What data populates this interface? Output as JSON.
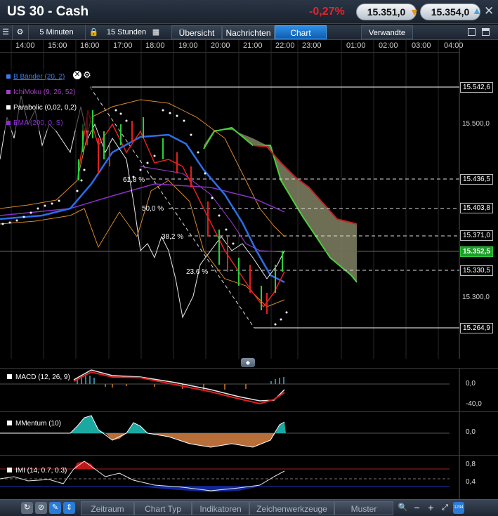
{
  "header": {
    "title": "US 30 - Cash",
    "change": "-0,27%",
    "bid": "15.351,0",
    "ask": "15.354,0"
  },
  "toolbar": {
    "interval": "5 Minuten",
    "range": "15 Stunden",
    "tabs": [
      "Übersicht",
      "Nachrichten",
      "Chart"
    ],
    "active_tab": "Chart",
    "related": "Verwandte"
  },
  "time_axis": [
    "14:00",
    "15:00",
    "16:00",
    "17:00",
    "18:00",
    "19:00",
    "20:00",
    "21:00",
    "22:00",
    "23:00",
    "01:00",
    "02:00",
    "03:00",
    "04:00"
  ],
  "price_axis": {
    "levels": [
      "15.542,6",
      "15.500,0",
      "15.436,5",
      "15.403,8",
      "15.371,0",
      "15.330,5",
      "15.300,0",
      "15.264,9"
    ],
    "current": "15.352,5"
  },
  "legend": {
    "items": [
      {
        "label": "B Bänder (20, 2)",
        "color": "#3a7de8"
      },
      {
        "label": "IchiMoku (9, 26, 52)",
        "color": "#a040c8"
      },
      {
        "label": "Parabolic (0,02, 0,2)",
        "color": "#ffffff"
      },
      {
        "label": "EMA (200, 0, S)",
        "color": "#8b2ed0"
      }
    ]
  },
  "fibonacci": [
    "61,8 %",
    "50,0 %",
    "38,2 %",
    "23,6 %"
  ],
  "indicators": {
    "macd": {
      "label": "MACD (12, 26, 9)",
      "values": [
        "0,0",
        "-40,0"
      ]
    },
    "momentum": {
      "label": "MMentum (10)",
      "values": [
        "0,0"
      ]
    },
    "imi": {
      "label": "IMI (14, 0.7, 0.3)",
      "values": [
        "0,8",
        "0,4"
      ]
    }
  },
  "bottombar": {
    "buttons": [
      "Zeitraum",
      "Chart Typ",
      "Indikatoren",
      "Zeichenwerkzeuge",
      "Muster"
    ],
    "zoom_badge": "1234"
  },
  "colors": {
    "negative": "#e8222a",
    "active_tab": "#1c7ad6",
    "current_price": "#1f9d2a"
  }
}
